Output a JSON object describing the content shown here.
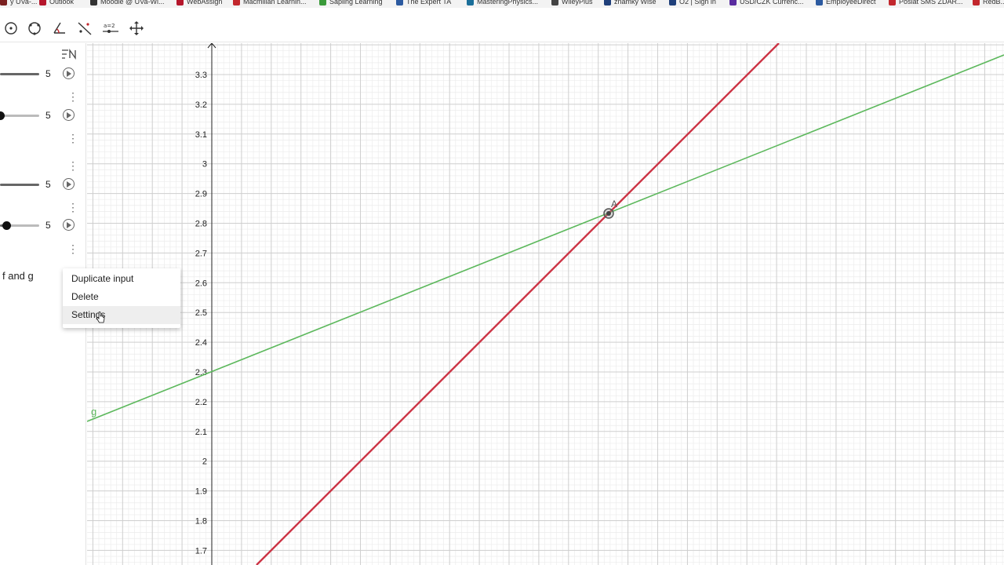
{
  "bookmarks": [
    {
      "label": "y UVa-...",
      "color": "#7a1f1f"
    },
    {
      "label": "Outlook",
      "color": "#b5162b"
    },
    {
      "label": "Moodle @ UVa-Wi...",
      "color": "#333333"
    },
    {
      "label": "WebAssign",
      "color": "#b5162b"
    },
    {
      "label": "Macmillan Learnin...",
      "color": "#c2272d"
    },
    {
      "label": "Sapling Learning",
      "color": "#3a9a3a"
    },
    {
      "label": "The Expert TA",
      "color": "#2c5aa0"
    },
    {
      "label": "MasteringPhysics...",
      "color": "#1b6f9a"
    },
    {
      "label": "WileyPlus",
      "color": "#444444"
    },
    {
      "label": "znamky Wise",
      "color": "#1f3f7a"
    },
    {
      "label": "O2 | Sign in",
      "color": "#1f3f7a"
    },
    {
      "label": "USD/CZK Currenc...",
      "color": "#5a2ca0"
    },
    {
      "label": "EmployeeDirect",
      "color": "#2c5aa0"
    },
    {
      "label": "Poslat SMS ZDAR...",
      "color": "#c2272d"
    },
    {
      "label": "RedB...",
      "color": "#c2272d"
    }
  ],
  "toolbar": {
    "tools": [
      "circle-center-icon",
      "circle-three-points-icon",
      "angle-icon",
      "reflect-line-icon",
      "slider-tool-icon",
      "move-graphics-icon"
    ],
    "slider_tool_text": "a=2"
  },
  "algebra": {
    "sliders": [
      {
        "value": "5",
        "fill": 1.0
      },
      {
        "value": "5",
        "fill": 0.0
      },
      {
        "value": "5",
        "fill": 1.0
      },
      {
        "value": "5",
        "fill": 0.16
      }
    ],
    "item_label": "f and g"
  },
  "context_menu": {
    "items": [
      "Duplicate input",
      "Delete",
      "Settings"
    ],
    "hovered_index": 2
  },
  "graph": {
    "y_ticks": [
      "3.3",
      "3.2",
      "3.1",
      "3",
      "2.9",
      "2.8",
      "2.7",
      "2.6",
      "2.5",
      "2.4",
      "2.3",
      "2.2",
      "2.1",
      "2",
      "1.9",
      "1.8",
      "1.7"
    ],
    "line_g_label": "g",
    "point_label": "A",
    "colors": {
      "line_f": "#cc3344",
      "line_g": "#5cb85c",
      "grid_major": "#cfcfcf",
      "grid_minor": "#ececec",
      "axis": "#222222"
    }
  }
}
